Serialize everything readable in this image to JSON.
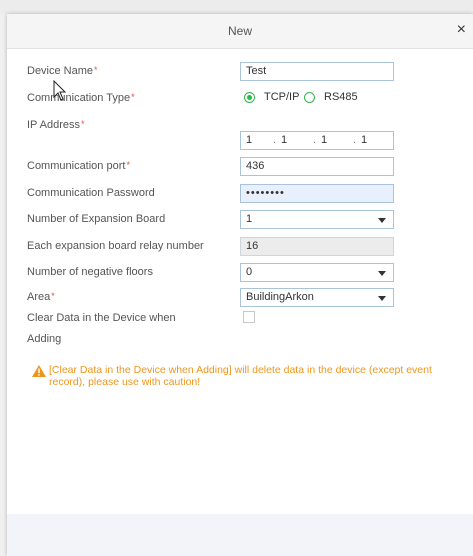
{
  "dialog": {
    "title": "New",
    "close_glyph": "×"
  },
  "form": {
    "device_name": {
      "label": "Device Name",
      "required_mark": "*",
      "value": "Test"
    },
    "communication_type": {
      "label": "Communication Type",
      "required_mark": "*",
      "options": [
        {
          "label": "TCP/IP",
          "selected": true
        },
        {
          "label": "RS485",
          "selected": false
        }
      ]
    },
    "ip_address": {
      "label": "IP Address",
      "required_mark": "*",
      "parts": [
        "1",
        "1",
        "1",
        "1"
      ]
    },
    "communication_port": {
      "label": "Communication port",
      "required_mark": "*",
      "value": "436"
    },
    "communication_password": {
      "label": "Communication Password",
      "value": "••••••••"
    },
    "expansion_board_count": {
      "label": "Number of Expansion Board",
      "value": "1"
    },
    "relay_number": {
      "label": "Each expansion board relay number",
      "value": "16"
    },
    "negative_floors": {
      "label": "Number of negative floors",
      "value": "0"
    },
    "area": {
      "label": "Area",
      "required_mark": "*",
      "value": "BuildingArkon"
    },
    "clear_data": {
      "label_line1": "Clear Data in the Device when",
      "label_line2": "Adding",
      "checked": false
    }
  },
  "warning": {
    "text": "[Clear Data in the Device when Adding] will delete data in the device (except event record), please use with caution!",
    "color": "#f0961c"
  },
  "colors": {
    "accent_green": "#2db84c",
    "required_red": "#e74c3c",
    "field_border": "#aac3dc"
  }
}
